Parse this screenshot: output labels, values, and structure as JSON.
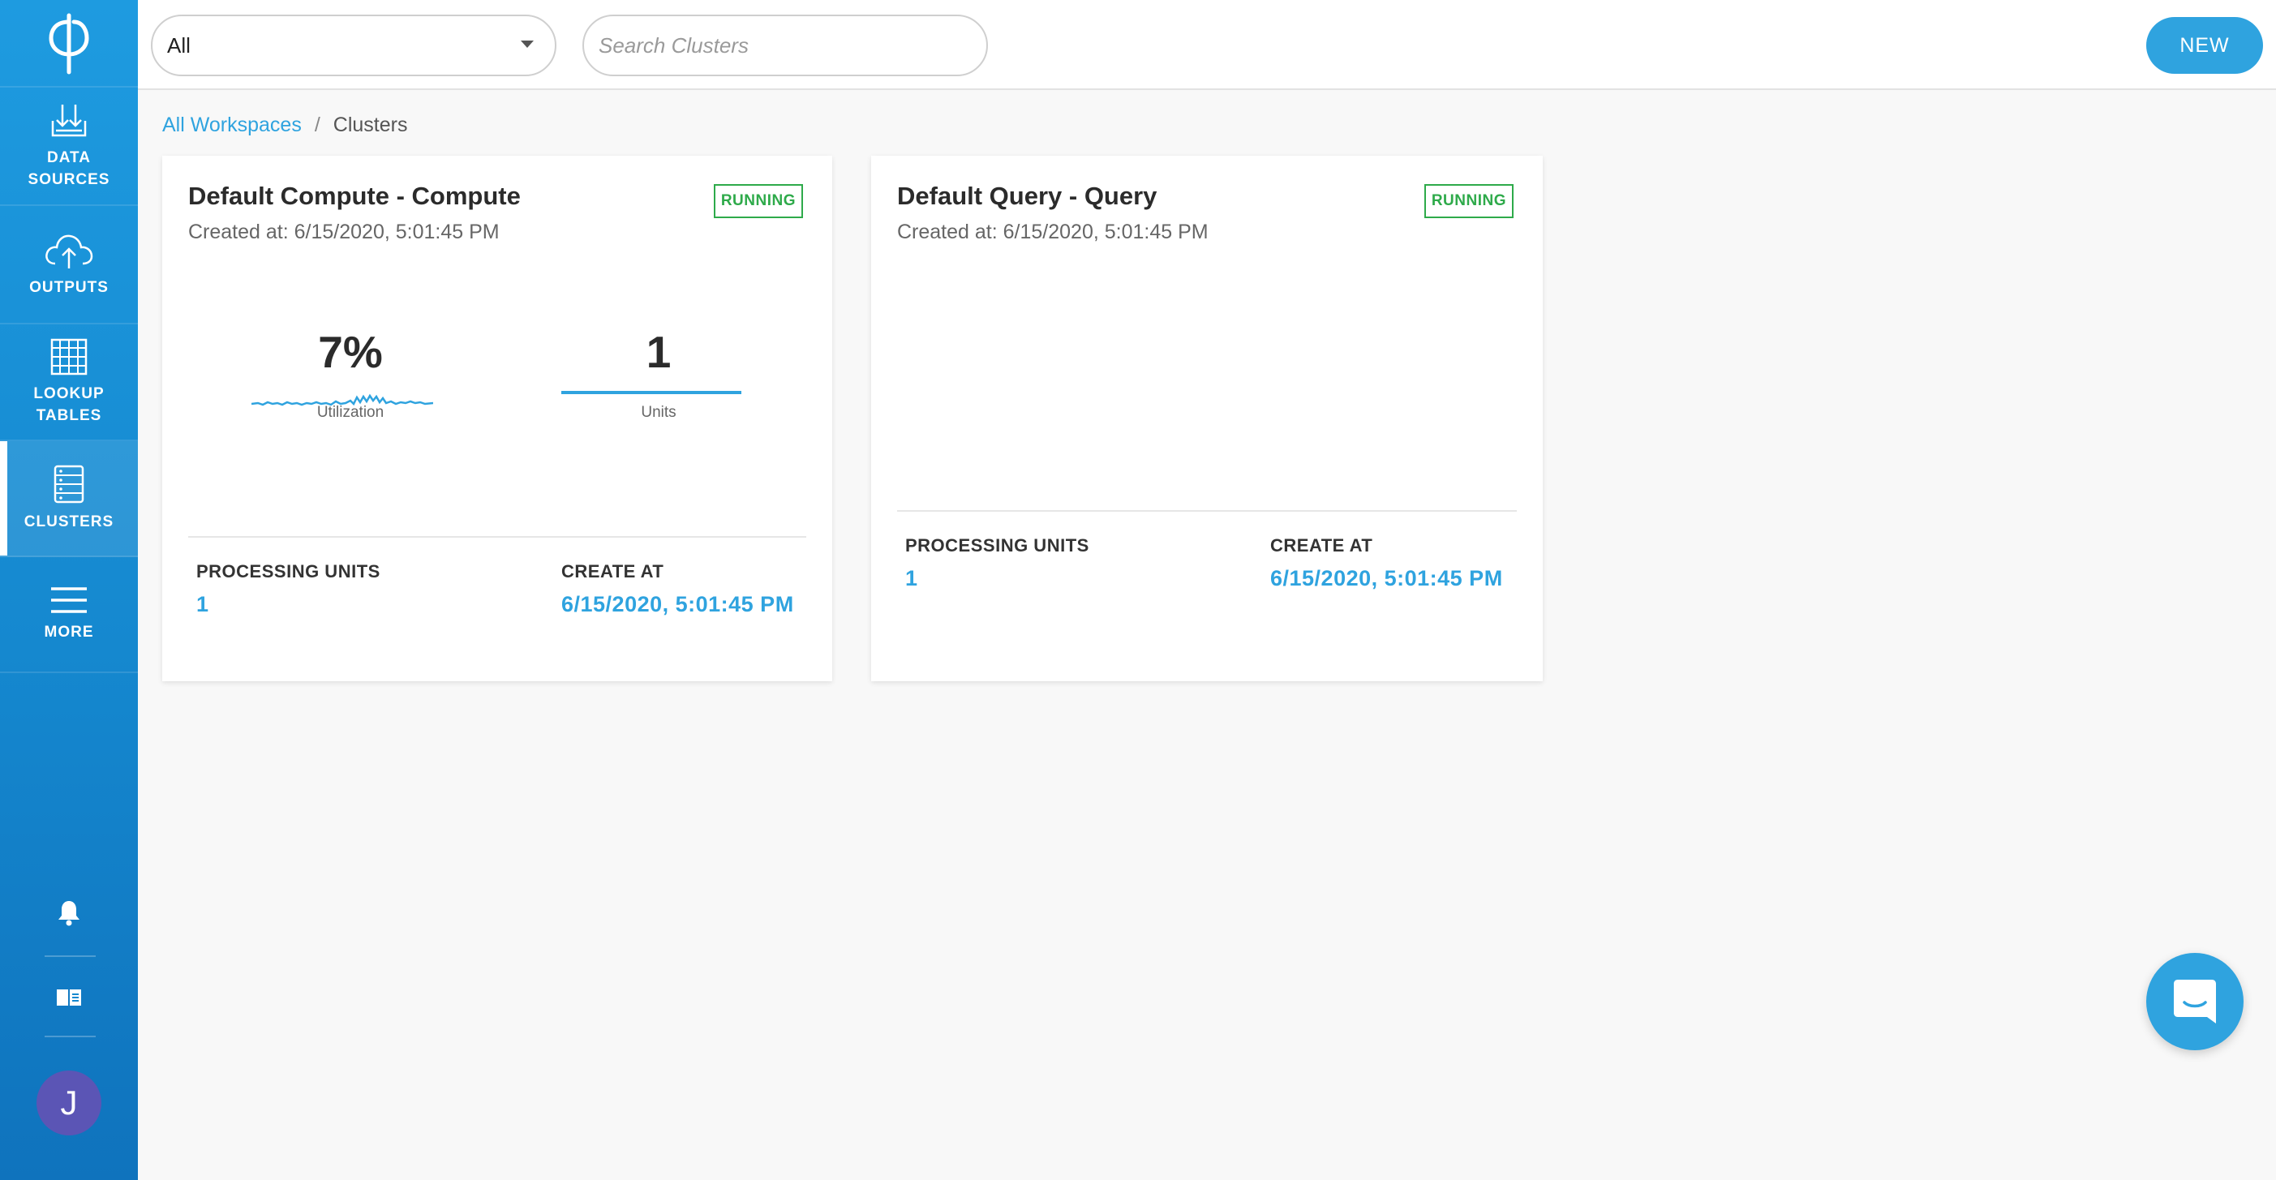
{
  "sidebar": {
    "logo_icon": "phi-logo-icon",
    "items": [
      {
        "label": "DATA\nSOURCES",
        "icon": "data-sources-icon"
      },
      {
        "label": "OUTPUTS",
        "icon": "cloud-upload-icon"
      },
      {
        "label": "LOOKUP\nTABLES",
        "icon": "grid-table-icon"
      },
      {
        "label": "CLUSTERS",
        "icon": "server-icon",
        "active": true
      },
      {
        "label": "MORE",
        "icon": "hamburger-icon"
      }
    ],
    "bottom": {
      "bell_icon": "bell-icon",
      "docs_icon": "book-icon",
      "avatar_initial": "J"
    }
  },
  "topbar": {
    "workspace_select": "All",
    "search_placeholder": "Search Clusters",
    "new_button": "NEW"
  },
  "breadcrumb": {
    "root": "All Workspaces",
    "separator": "/",
    "current": "Clusters"
  },
  "clusters": [
    {
      "title": "Default Compute - Compute",
      "created": "Created at: 6/15/2020, 5:01:45 PM",
      "status": "RUNNING",
      "utilization_value": "7%",
      "utilization_label": "Utilization",
      "units_value": "1",
      "units_label": "Units",
      "processing_units_label": "PROCESSING UNITS",
      "processing_units_value": "1",
      "create_at_label": "CREATE AT",
      "create_at_value": "6/15/2020, 5:01:45 PM"
    },
    {
      "title": "Default Query - Query",
      "created": "Created at: 6/15/2020, 5:01:45 PM",
      "status": "RUNNING",
      "processing_units_label": "PROCESSING UNITS",
      "processing_units_value": "1",
      "create_at_label": "CREATE AT",
      "create_at_value": "6/15/2020, 5:01:45 PM"
    }
  ],
  "colors": {
    "accent": "#2fa3df",
    "sidebar": "#1588cf",
    "running": "#2eaa4a",
    "avatar": "#5b55b5"
  },
  "chat_icon": "chat-bubble-icon"
}
